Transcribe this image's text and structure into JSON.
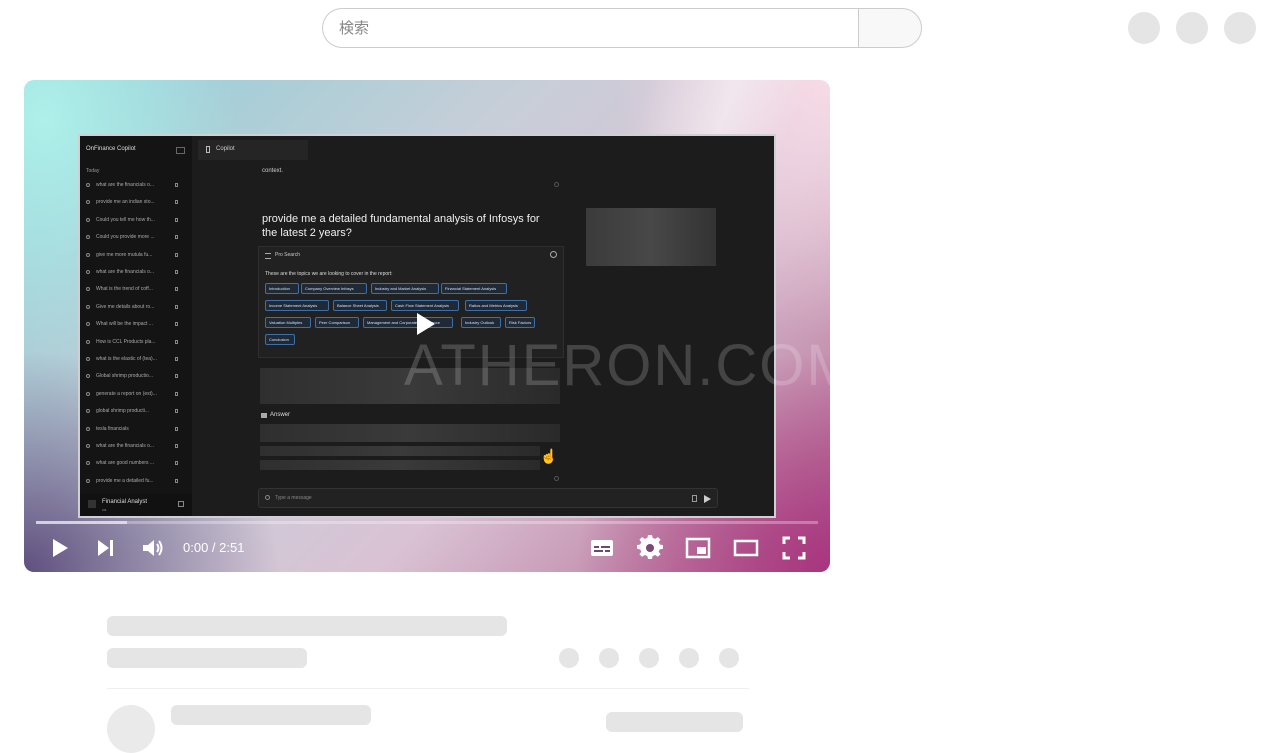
{
  "search": {
    "placeholder": "検索",
    "value": ""
  },
  "header": {
    "icons": [
      "avatar-placeholder",
      "avatar-placeholder",
      "avatar-placeholder"
    ]
  },
  "video": {
    "watermark": "ATHERON.COM",
    "frame": {
      "app_name": "OnFinance Copilot",
      "today_label": "Today",
      "history": [
        "what are the financials o...",
        "provide me an indian sto...",
        "Could you tell me how th...",
        "Could you provide more ...",
        "give me more mutula fu...",
        "what are the financials o...",
        "What is the trend of coff...",
        "Give me details about ro...",
        "What will be the impact ...",
        "How is CCL Products pla...",
        "what is the elastic of (tea)...",
        "Global shrimp productio...",
        "generate a report on (est)...",
        "global shrimp producti...",
        "tesla financials",
        "what are the financials o...",
        "what are good numbers ...",
        "provide me a detailed fu..."
      ],
      "user_name": "Financial Analyst",
      "user_sub": "ca",
      "tab_label": "Copilot",
      "context_text": "context.",
      "question": "provide me a detailed fundamental analysis of Infosys for the latest 2 years?",
      "pro_search_label": "Pro Search",
      "topics_intro": "These are the topics we are looking to cover in the report:",
      "topics": [
        "Introduction",
        "Company Overview Infosys",
        "Industry and Market Analysis",
        "Financial Statement Analysis",
        "Income Statement Analysis",
        "Balance Sheet Analysis",
        "Cash Flow Statement Analysis",
        "Ratios and Metrics Analysis",
        "Valuation Multiples",
        "Peer Comparison",
        "Management and Corporate Governance",
        "Industry Outlook",
        "Risk Factors",
        "Conclusion"
      ],
      "answer_label": "Answer",
      "message_placeholder": "Type a message"
    },
    "controls": {
      "time": "0:00 / 2:51",
      "progress_loaded_fraction": 0.117,
      "progress_played_fraction": 0
    }
  }
}
